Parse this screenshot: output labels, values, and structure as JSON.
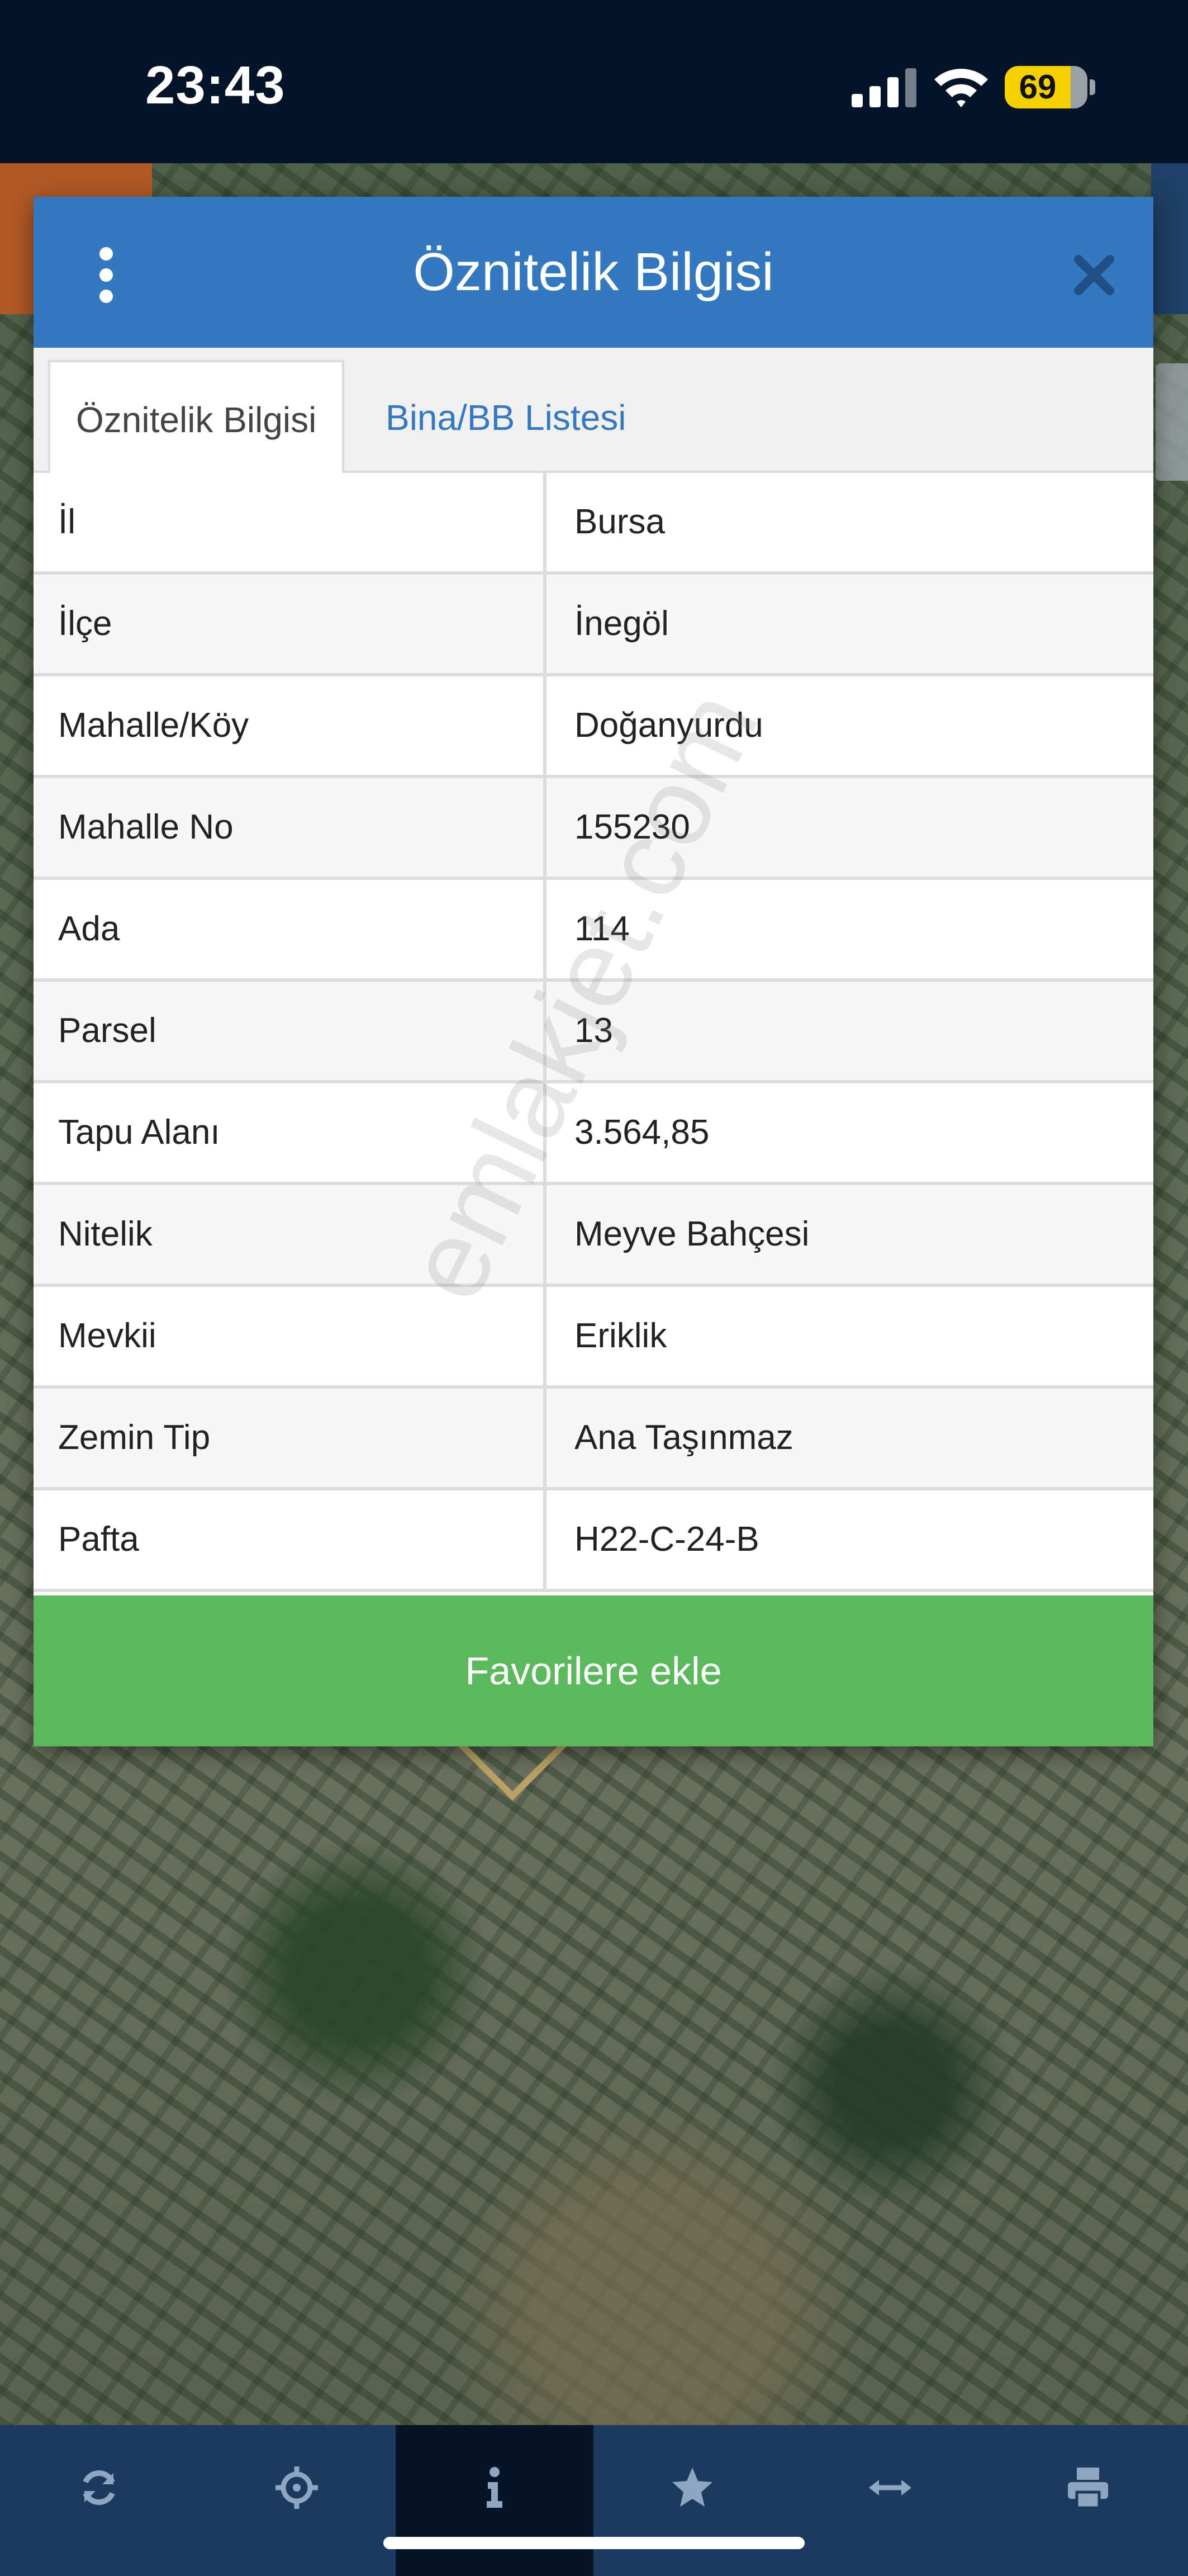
{
  "status_bar": {
    "time": "23:43",
    "battery_level": "69",
    "icons": [
      "cellular-signal-icon",
      "wifi-icon",
      "battery-icon"
    ]
  },
  "dialog": {
    "title": "Öznitelik Bilgisi",
    "menu_icon": "kebab-menu-icon",
    "close_icon": "close-icon",
    "tabs": [
      {
        "label": "Öznitelik Bilgisi",
        "active": true
      },
      {
        "label": "Bina/BB Listesi",
        "active": false
      }
    ],
    "rows": [
      {
        "label": "İl",
        "value": "Bursa"
      },
      {
        "label": "İlçe",
        "value": "İnegöl"
      },
      {
        "label": "Mahalle/Köy",
        "value": "Doğanyurdu"
      },
      {
        "label": "Mahalle No",
        "value": "155230"
      },
      {
        "label": "Ada",
        "value": "114"
      },
      {
        "label": "Parsel",
        "value": "13"
      },
      {
        "label": "Tapu Alanı",
        "value": "3.564,85"
      },
      {
        "label": "Nitelik",
        "value": "Meyve Bahçesi"
      },
      {
        "label": "Mevkii",
        "value": "Eriklik"
      },
      {
        "label": "Zemin Tip",
        "value": "Ana Taşınmaz"
      },
      {
        "label": "Pafta",
        "value": "H22-C-24-B"
      }
    ],
    "favorite_button": "Favorilere ekle"
  },
  "watermark": "emlakjet.com",
  "toolbar": {
    "items": [
      {
        "icon": "refresh-icon",
        "active": false
      },
      {
        "icon": "locate-crosshair-icon",
        "active": false
      },
      {
        "icon": "info-icon",
        "active": true
      },
      {
        "icon": "star-icon",
        "active": false
      },
      {
        "icon": "measure-arrows-icon",
        "active": false
      },
      {
        "icon": "print-icon",
        "active": false
      }
    ]
  },
  "colors": {
    "header_blue": "#3478c0",
    "button_green": "#5cb85c",
    "status_bar_bg": "#041428",
    "toolbar_bg": "#1b3a5e",
    "battery_yellow": "#f5d000"
  }
}
